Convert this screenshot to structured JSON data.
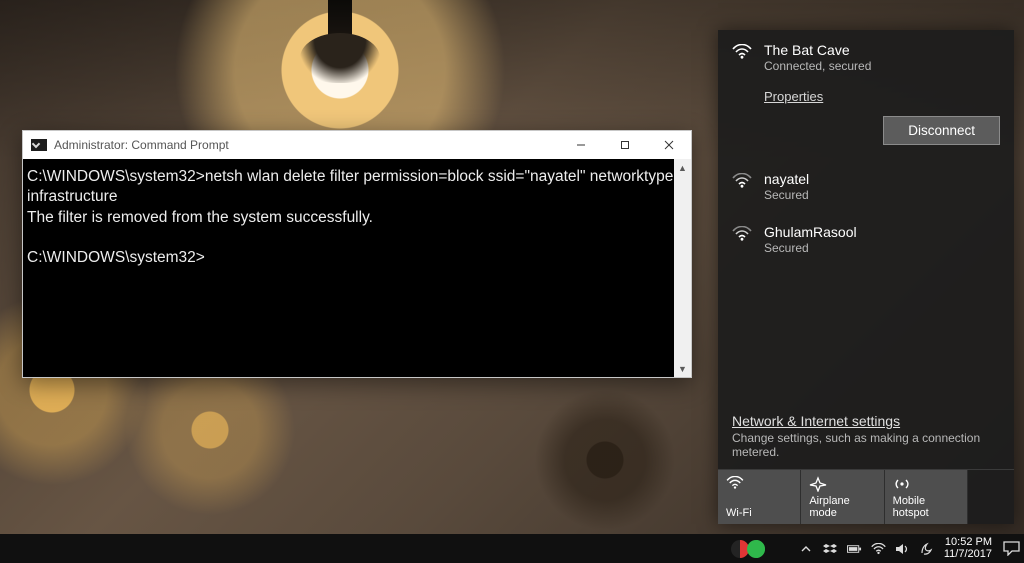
{
  "cmd": {
    "title": "Administrator: Command Prompt",
    "prompt1": "C:\\WINDOWS\\system32>",
    "command": "netsh wlan delete filter permission=block ssid=\"nayatel\" networktype=infrastructure",
    "output": "The filter is removed from the system successfully.",
    "prompt2": "C:\\WINDOWS\\system32>"
  },
  "network": {
    "connected": {
      "name": "The Bat Cave",
      "status": "Connected, secured",
      "properties_label": "Properties",
      "disconnect_label": "Disconnect"
    },
    "others": [
      {
        "name": "nayatel",
        "status": "Secured"
      },
      {
        "name": "GhulamRasool",
        "status": "Secured"
      }
    ],
    "footer": {
      "link": "Network & Internet settings",
      "sub": "Change settings, such as making a connection metered."
    },
    "quick": {
      "wifi": "Wi-Fi",
      "airplane": "Airplane mode",
      "hotspot": "Mobile hotspot"
    }
  },
  "taskbar": {
    "time": "10:52 PM",
    "date": "11/7/2017"
  }
}
